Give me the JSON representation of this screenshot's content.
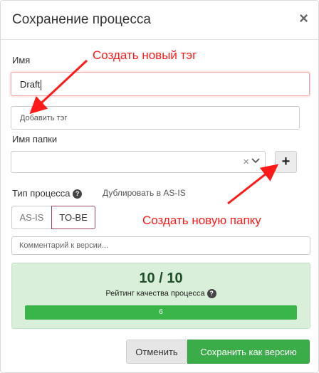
{
  "dialog": {
    "title": "Сохранение процесса",
    "close_symbol": "×"
  },
  "name_field": {
    "label": "Имя",
    "value": "Draft"
  },
  "tag_field": {
    "placeholder": "Добавить тэг"
  },
  "folder_field": {
    "label": "Имя папки",
    "value": "",
    "clear_symbol": "×",
    "add_symbol": "+"
  },
  "process_type": {
    "label": "Тип процесса",
    "help_symbol": "?",
    "duplicate_text": "Дублировать в AS-IS",
    "options": [
      "AS-IS",
      "TO-BE"
    ],
    "selected": "TO-BE"
  },
  "comment_field": {
    "placeholder": "Комментарий к версии..."
  },
  "rating": {
    "score_text": "10 / 10",
    "label": "Рейтинг качества процесса",
    "help_symbol": "?",
    "progress_value": 6,
    "progress_fraction": 1.0
  },
  "footer": {
    "cancel_label": "Отменить",
    "save_label": "Сохранить как версию"
  },
  "annotations": {
    "create_tag": "Создать новый тэг",
    "create_folder": "Создать новую папку",
    "color": "#ff1a1a"
  },
  "colors": {
    "success": "#3ab54a",
    "rating_bg": "#d9efd9",
    "to_be_border": "#a6436b"
  }
}
